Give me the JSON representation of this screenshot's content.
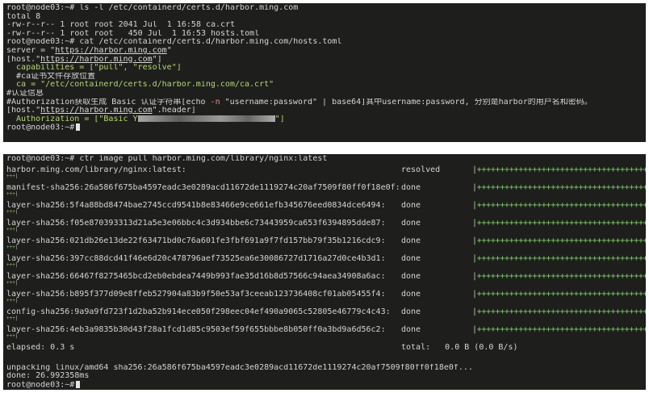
{
  "terminal_top": {
    "prompt": "root@node03:~#",
    "cmd_ls": "ls -l /etc/containerd/certs.d/harbor.ming.com",
    "total": "total 8",
    "files": [
      {
        "perm": "-rw-r--r--",
        "links": "1",
        "user": "root",
        "group": "root",
        "size": "2041",
        "month": "Jul",
        "day": "1",
        "time": "16:58",
        "name": "ca.crt"
      },
      {
        "perm": "-rw-r--r--",
        "links": "1",
        "user": "root",
        "group": "root",
        "size": " 450",
        "month": "Jul",
        "day": "1",
        "time": "16:53",
        "name": "hosts.toml"
      }
    ],
    "cmd_cat": "cat /etc/containerd/certs.d/harbor.ming.com/hosts.toml",
    "server_key": "server = \"",
    "server_url": "https://harbor.ming.com",
    "server_end": "\"",
    "host_open": "[host.\"",
    "host_url": "https://harbor.ming.com",
    "host_close": "\"]",
    "capabilities": "  capabilities = [\"pull\", \"resolve\"]",
    "ca_comment": "  #ca证书文件存放位置",
    "ca_path": "  ca = \"/etc/containerd/certs.d/harbor.ming.com/ca.crt\"",
    "auth_comment": "#认证信息",
    "auth_note_a": "#Authorization获取生成 Basic 认证字符串[echo ",
    "auth_note_flag": "-n",
    "auth_note_b": " \"username:password\" | base64]其中username:password, 分别是harbor的用户名和密码。",
    "header_open": "[host.\"",
    "header_url": "https://harbor.ming.com",
    "header_close": "\".header]",
    "auth_line_a": "  Authorization = [\"Basic Y",
    "auth_line_b": "\"]"
  },
  "terminal_bottom": {
    "prompt": "root@node03:~#",
    "cmd_pull": "ctr image pull harbor.ming.com/library/nginx:latest",
    "progress_rows": [
      {
        "name": "harbor.ming.com/library/nginx:latest:",
        "status": "resolved",
        "bar": "|++++++++++++++++++++++++++++++++++++++|",
        "sub_plus": "+++",
        "sub_pipe": "|"
      },
      {
        "name": "manifest-sha256:26a586f675ba4597eadc3e0289acd11672de1119274c20af7509f80ff0f18e0f:",
        "status": "done",
        "bar": "|++++++++++++++++++++++++++++++++++++++|",
        "sub_plus": "+++",
        "sub_pipe": "|"
      },
      {
        "name": "layer-sha256:5f4a88bd8474bae2745ccd9541b8e83466e9ce661efb345676eed0834dce6494:",
        "status": "done",
        "bar": "|++++++++++++++++++++++++++++++++++++++|",
        "sub_plus": "+++",
        "sub_pipe": "|"
      },
      {
        "name": "layer-sha256:f05e870393313d21a5e3e06bbc4c3d934bbe6c73443959ca653f6394895dde87:",
        "status": "done",
        "bar": "|++++++++++++++++++++++++++++++++++++++|",
        "sub_plus": "+++",
        "sub_pipe": "|"
      },
      {
        "name": "layer-sha256:021db26e13de22f63471bd0c76a601fe3fbf691a9f7fd157bb79f35b1216cdc9:",
        "status": "done",
        "bar": "|++++++++++++++++++++++++++++++++++++++|",
        "sub_plus": "+++",
        "sub_pipe": "|"
      },
      {
        "name": "layer-sha256:397cc88dcd41f46e6d20c478796aef73525ea6e30086727d1716a27d0ce4b3d1:",
        "status": "done",
        "bar": "|++++++++++++++++++++++++++++++++++++++|",
        "sub_plus": "+++",
        "sub_pipe": "|"
      },
      {
        "name": "layer-sha256:66467f8275465bcd2eb0ebdea7449b993fae35d16b8d57566c94aea34908a6ac:",
        "status": "done",
        "bar": "|++++++++++++++++++++++++++++++++++++++|",
        "sub_plus": "+++",
        "sub_pipe": "|"
      },
      {
        "name": "layer-sha256:b895f377d09e8ffeb527904a83b9f50e53af3ceeab123736408cf01ab05455f4:",
        "status": "done",
        "bar": "|++++++++++++++++++++++++++++++++++++++|",
        "sub_plus": "+++",
        "sub_pipe": "|"
      },
      {
        "name": "config-sha256:9a9a9fd723f1d2ba52b914ece050f298eec04ef490a9065c52805e46779c4c43:",
        "status": "done",
        "bar": "|++++++++++++++++++++++++++++++++++++++|",
        "sub_plus": "+++",
        "sub_pipe": "|"
      },
      {
        "name": "layer-sha256:4eb3a9835b30d43f28a1fcd1d85c9503ef59f655bbbe8b050ff0a3bd9a6d56c2:",
        "status": "done",
        "bar": "|++++++++++++++++++++++++++++++++++++++|",
        "sub_plus": "+++",
        "sub_pipe": "|"
      }
    ],
    "elapsed": "elapsed: 0.3 s",
    "total": "total:   0.0 B (0.0 B/s)",
    "unpacking": "unpacking linux/amd64 sha256:26a586f675ba4597eadc3e0289acd11672de1119274c20af7509f80ff0f18e0f...",
    "done": "done: 26.992358ms"
  },
  "colors": {
    "terminal_bg": "#1e1f1c",
    "text": "#d4d4d4",
    "string": "#b8d27a",
    "plus": "#7fd06a"
  }
}
